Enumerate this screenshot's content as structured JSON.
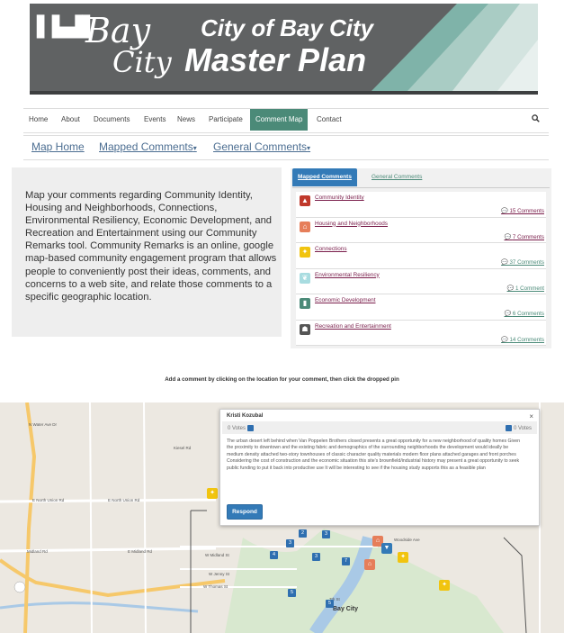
{
  "banner": {
    "logo_line1": "Bay",
    "logo_line2": "City",
    "title_line1": "City of Bay City",
    "title_line2": "Master Plan",
    "colors": {
      "bg": "#606263",
      "stripe1": "#7fb3a9",
      "stripe2": "#a9ccc4",
      "stripe3": "#d4e4e0"
    }
  },
  "nav": {
    "items": [
      "Home",
      "About",
      "Documents",
      "Events",
      "News",
      "Participate",
      "Comment Map",
      "Contact"
    ],
    "active": "Comment Map",
    "search_icon": "search-icon"
  },
  "subnav": {
    "map_home": "Map Home",
    "mapped_comments": "Mapped Comments",
    "general_comments": "General Comments",
    "caret": "▾"
  },
  "intro": {
    "text": "Map your comments regarding Community Identity, Housing and Neighborhoods, Connections, Environmental Resiliency, Economic Development, and Recreation and Entertainment using our Community Remarks tool. Community Remarks is an online, google map-based community engagement program that allows people to conveniently post their ideas, comments, and concerns to a web site, and relate those comments to a specific geographic location."
  },
  "panel": {
    "tabs": [
      "Mapped Comments",
      "General Comments"
    ],
    "categories": [
      {
        "name": "Community Identity",
        "count": "15 Comments",
        "icon": "community-identity-icon",
        "color": "#c0392b",
        "count_color": "#7a1e4b"
      },
      {
        "name": "Housing and Neighborhoods",
        "count": "7 Comments",
        "icon": "house-icon",
        "color": "#e67e5a",
        "count_color": "#7a1e4b"
      },
      {
        "name": "Connections",
        "count": "37 Comments",
        "icon": "pedestrian-icon",
        "color": "#f1c40f",
        "count_color": "#4b8a78"
      },
      {
        "name": "Environmental Resiliency",
        "count": "1 Comment",
        "icon": "leaf-icon",
        "color": "#a8dce0",
        "count_color": "#4b8a78"
      },
      {
        "name": "Economic Development",
        "count": "6 Comments",
        "icon": "chart-icon",
        "color": "#4b8a78",
        "count_color": "#4b8a78"
      },
      {
        "name": "Recreation and Entertainment",
        "count": "14 Comments",
        "icon": "recreation-icon",
        "color": "#555555",
        "count_color": "#4b8a78"
      }
    ]
  },
  "map": {
    "hint": "Add a comment by clicking on the location for your comment, then click the dropped pin",
    "labels": [
      "N Water Ave Dr",
      "Kiesel Rd",
      "E North Union Rd",
      "E North Union Rd",
      "Midland Rd",
      "E Midland Rd",
      "W Midland St",
      "W Jenny St",
      "W Thomas St",
      "Woodside Ave",
      "Bay City",
      "7th St"
    ],
    "city": "Bay City"
  },
  "popup": {
    "author": "Kristi Kozubal",
    "close": "×",
    "votes_up": "0 Votes",
    "votes_down": "0 Votes",
    "body": "The urban desert left behind when Van Poppelen Brothers closed presents a great opportunity for a new neighborhood of quality homes Given the proximity to downtown and the existing fabric and demographics of the surrounding neighborhoods the development would ideally be medium density attached two-story townhouses of classic character quality materials modern floor plans attached garages and front porches Considering the cost of construction and the economic situation this site's brownfield/industrial history may present a great opportunity to seek public funding to put it back into productive use It will be interesting to see if the housing study supports this as a feasible plan",
    "respond": "Respond"
  },
  "markers": [
    "2",
    "3",
    "3",
    "4",
    "3",
    "7",
    "5",
    "5"
  ]
}
